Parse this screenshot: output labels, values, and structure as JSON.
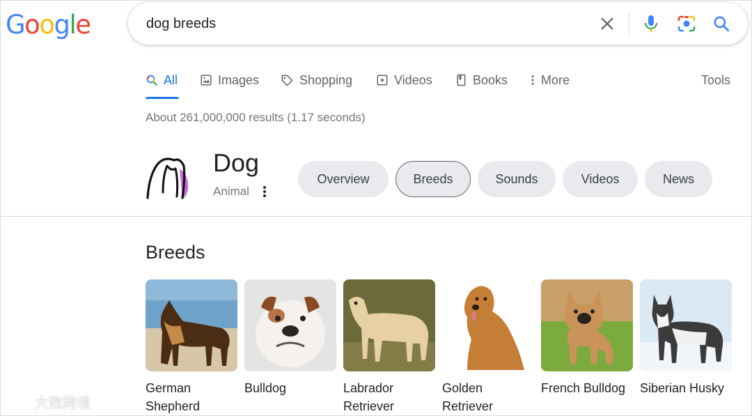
{
  "logo": {
    "letters": [
      "G",
      "o",
      "o",
      "g",
      "l",
      "e"
    ],
    "colors": [
      "#4285F4",
      "#EA4335",
      "#FBBC05",
      "#4285F4",
      "#34A853",
      "#EA4335"
    ]
  },
  "search": {
    "query": "dog breeds",
    "icons": [
      "close-icon",
      "mic-icon",
      "camera-icon",
      "search-icon"
    ]
  },
  "tabs": [
    {
      "label": "All",
      "icon": "search-icon",
      "active": true
    },
    {
      "label": "Images",
      "icon": "image-icon"
    },
    {
      "label": "Shopping",
      "icon": "tag-icon"
    },
    {
      "label": "Videos",
      "icon": "play-icon"
    },
    {
      "label": "Books",
      "icon": "book-icon"
    },
    {
      "label": "More",
      "icon": "more-vert-icon"
    }
  ],
  "tools_label": "Tools",
  "result_stats": "About 261,000,000 results (1.17 seconds)",
  "entity": {
    "title": "Dog",
    "subtitle": "Animal"
  },
  "chips": [
    {
      "label": "Overview"
    },
    {
      "label": "Breeds",
      "selected": true
    },
    {
      "label": "Sounds"
    },
    {
      "label": "Videos"
    },
    {
      "label": "News"
    }
  ],
  "breeds_section": {
    "title": "Breeds",
    "items": [
      {
        "line1": "German",
        "line2": "Shepherd"
      },
      {
        "line1": "Bulldog",
        "line2": ""
      },
      {
        "line1": "Labrador",
        "line2": "Retriever"
      },
      {
        "line1": "Golden",
        "line2": "Retriever"
      },
      {
        "line1": "French Bulldog",
        "line2": ""
      },
      {
        "line1": "Siberian Husky",
        "line2": ""
      }
    ]
  },
  "watermark": "大数跨境",
  "colors": {
    "accent": "#1a73e8",
    "text": "#202124",
    "muted": "#5f6368",
    "chip_bg": "#e8eaed"
  }
}
